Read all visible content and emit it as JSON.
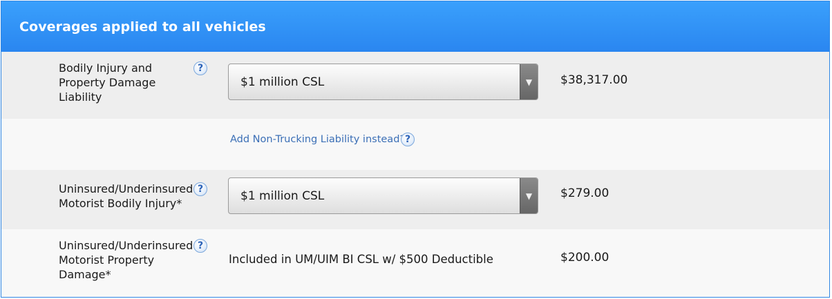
{
  "header": {
    "title": "Coverages applied to all vehicles"
  },
  "help_glyph": "?",
  "dropdown_arrow": "▼",
  "rows": [
    {
      "label": "Bodily Injury and Property Damage Liability",
      "selected": "$1 million CSL",
      "price": "$38,317.00"
    },
    {
      "link": "Add Non-Trucking Liability instead?"
    },
    {
      "label": "Uninsured/Underinsured Motorist Bodily Injury*",
      "selected": "$1 million CSL",
      "price": "$279.00"
    },
    {
      "label": "Uninsured/Underinsured Motorist Property Damage*",
      "value_text": "Included in UM/UIM BI CSL w/ $500 Deductible",
      "price": "$200.00"
    }
  ]
}
